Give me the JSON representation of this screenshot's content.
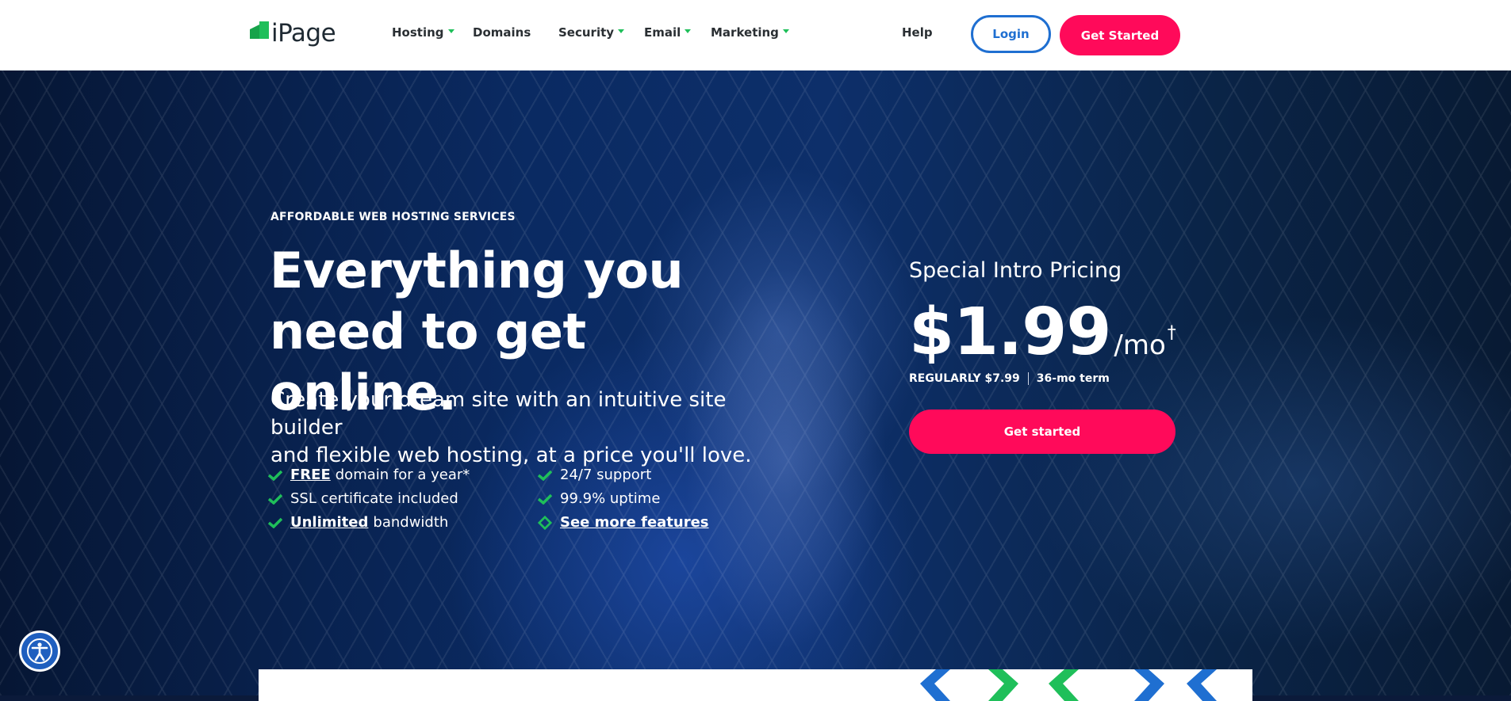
{
  "brand": {
    "name": "iPage",
    "accent": "#1fbf5a",
    "cta": "#ff0a5a",
    "link": "#1f6fd1"
  },
  "nav": {
    "items": [
      {
        "label": "Hosting",
        "dropdown": true
      },
      {
        "label": "Domains",
        "dropdown": false
      },
      {
        "label": "Security",
        "dropdown": true
      },
      {
        "label": "Email",
        "dropdown": true
      },
      {
        "label": "Marketing",
        "dropdown": true
      }
    ],
    "help": "Help",
    "login": "Login",
    "get_started": "Get Started"
  },
  "hero": {
    "eyebrow": "AFFORDABLE WEB HOSTING SERVICES",
    "headline_line1": "Everything you",
    "headline_line2": "need to get online.",
    "subhead_line1": "Create your dream site with an intuitive site builder",
    "subhead_line2": "and flexible web hosting, at a price you'll love.",
    "features": [
      {
        "bold": "FREE",
        "text": "domain for a year*"
      },
      {
        "bold": "",
        "text": "SSL certificate included"
      },
      {
        "bold": "Unlimited",
        "text": "bandwidth"
      },
      {
        "bold": "",
        "text": "24/7 support"
      },
      {
        "bold": "",
        "text": "99.9% uptime"
      },
      {
        "bold": "See more features",
        "text": ""
      }
    ]
  },
  "pricing": {
    "label": "Special Intro Pricing",
    "price": "$1.99",
    "per": "/mo",
    "dagger": "†",
    "regular": "REGULARLY $7.99",
    "term": "36-mo term",
    "cta": "Get started"
  },
  "icons": {
    "check": "check-icon",
    "diamond": "diamond-check-icon",
    "accessibility": "accessibility-icon"
  }
}
